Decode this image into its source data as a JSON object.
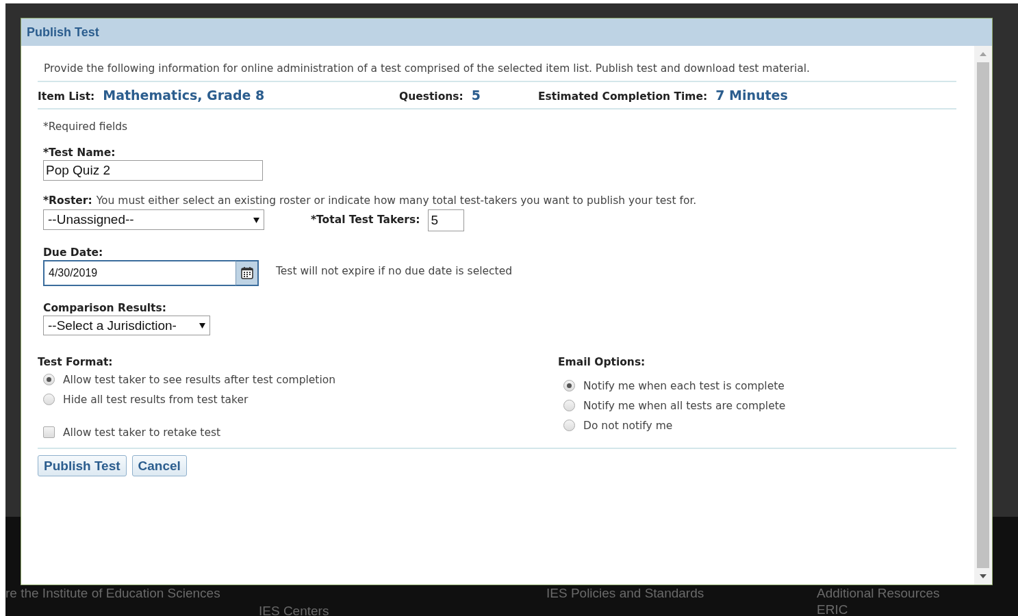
{
  "background_page": {
    "footer_texts": [
      "re the Institute of Education Sciences",
      "IES Centers",
      "IES Policies and Standards",
      "Additional Resources",
      "ERIC"
    ]
  },
  "dialog": {
    "title": "Publish Test",
    "intro": "Provide the following information for online administration of a test comprised of the selected item list. Publish test and download test material.",
    "summary": [
      {
        "label": "Item List:",
        "value": "Mathematics, Grade 8"
      },
      {
        "label": "Questions:",
        "value": "5"
      },
      {
        "label": "Estimated Completion Time:",
        "value": "7 Minutes"
      }
    ],
    "required_note": "*Required fields",
    "test_name": {
      "label": "*Test Name:",
      "value": "Pop Quiz 2"
    },
    "roster": {
      "label": "*Roster:",
      "hint": "You must either select an existing roster or indicate how many total test-takers you want to publish your test for.",
      "value": "--Unassigned--"
    },
    "total_test_takers": {
      "label": "*Total Test Takers:",
      "value": "5"
    },
    "due_date": {
      "label": "Due Date:",
      "value": "4/30/2019",
      "focused": true,
      "note": "Test will not expire if no due date is selected"
    },
    "comparison_results": {
      "label": "Comparison Results:",
      "value": "--Select a Jurisdiction-"
    },
    "test_format": {
      "label": "Test Format:",
      "options": [
        {
          "label": "Allow test taker to see results after test completion",
          "selected": true
        },
        {
          "label": "Hide all test results from test taker",
          "selected": false
        }
      ]
    },
    "retake": {
      "label": "Allow test taker to retake test",
      "checked": false
    },
    "email_options": {
      "label": "Email Options:",
      "options": [
        {
          "label": "Notify me when each test is complete",
          "selected": true
        },
        {
          "label": "Notify me when all tests are complete",
          "selected": false
        },
        {
          "label": "Do not notify me",
          "selected": false
        }
      ]
    },
    "buttons": [
      "Publish Test",
      "Cancel"
    ]
  }
}
